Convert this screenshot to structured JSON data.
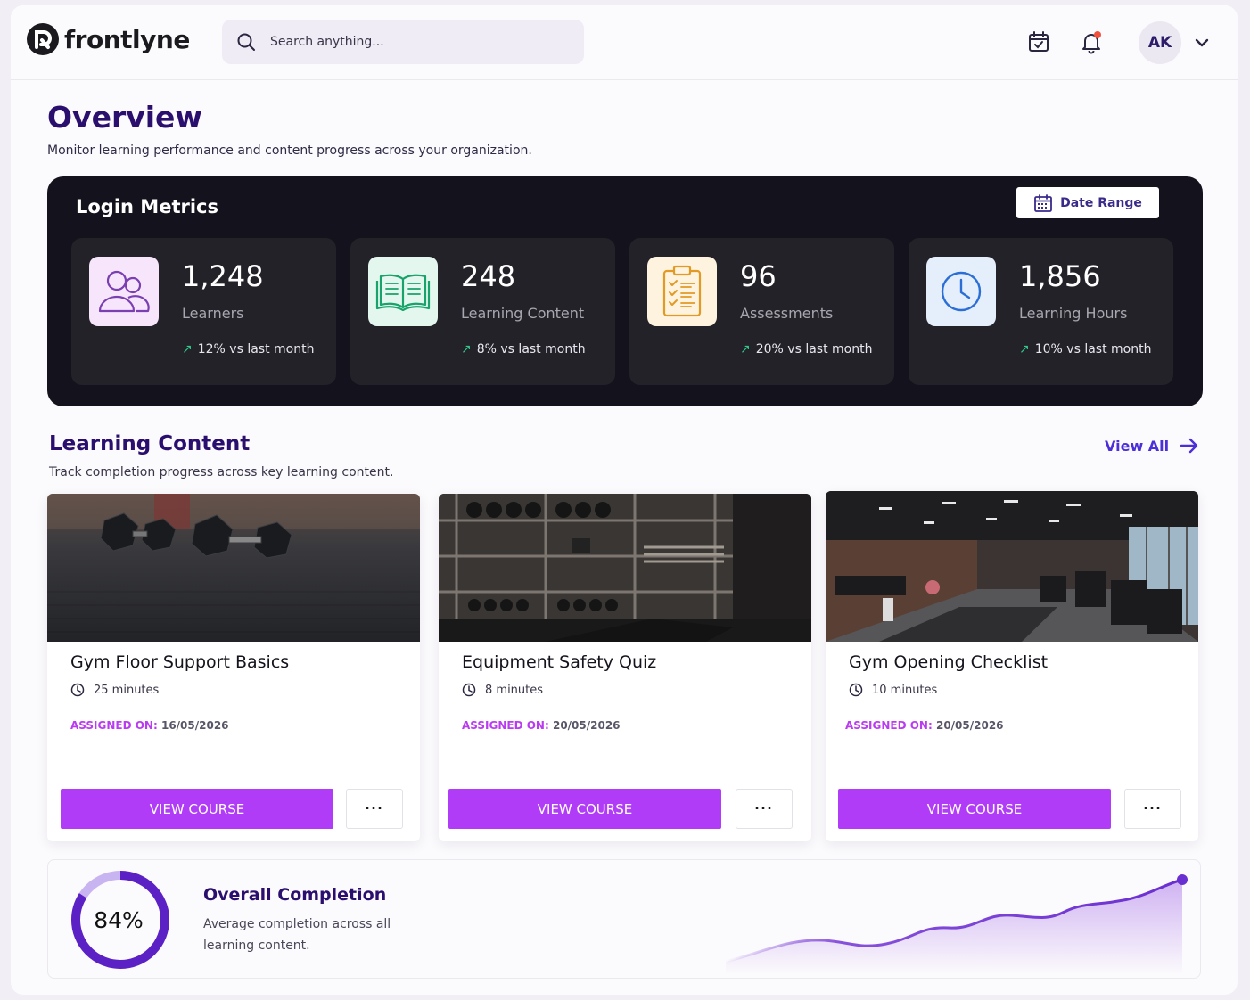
{
  "brand": {
    "name": "frontlyne"
  },
  "search": {
    "placeholder": "Search anything..."
  },
  "user": {
    "initials": "AK"
  },
  "page": {
    "title": "Overview",
    "subtitle": "Monitor learning performance and content progress across your organization."
  },
  "metrics": {
    "title": "Login Metrics",
    "date_range_label": "Date Range",
    "cards": [
      {
        "value": "1,248",
        "label": "Learners",
        "trend": "12% vs last month",
        "icon": "users-icon",
        "icon_bg": "#f7e6fb"
      },
      {
        "value": "248",
        "label": "Learning Content",
        "trend": "8% vs last month",
        "icon": "book-icon",
        "icon_bg": "#e4f7ef"
      },
      {
        "value": "96",
        "label": "Assessments",
        "trend": "20% vs last month",
        "icon": "clipboard-checklist-icon",
        "icon_bg": "#fdf3df"
      },
      {
        "value": "1,856",
        "label": "Learning Hours",
        "trend": "10% vs last month",
        "icon": "clock-icon",
        "icon_bg": "#e5eefb"
      }
    ]
  },
  "learning": {
    "title": "Learning Content",
    "subtitle": "Track completion progress across key learning content.",
    "view_all": "View All",
    "courses": [
      {
        "title": "Gym Floor Support Basics",
        "duration": "25 minutes",
        "assigned_label": "ASSIGNED ON:",
        "assigned_date": "16/05/2026",
        "button": "VIEW COURSE",
        "more": "···",
        "image": "dumbbells-photo"
      },
      {
        "title": "Equipment Safety Quiz",
        "duration": "8 minutes",
        "assigned_label": "ASSIGNED ON:",
        "assigned_date": "20/05/2026",
        "button": "VIEW COURSE",
        "more": "···",
        "image": "weights-rack-photo"
      },
      {
        "title": "Gym Opening Checklist",
        "duration": "10 minutes",
        "assigned_label": "ASSIGNED ON:",
        "assigned_date": "20/05/2026",
        "button": "VIEW COURSE",
        "more": "···",
        "image": "gym-interior-photo"
      }
    ]
  },
  "completion": {
    "title": "Overall Completion",
    "percent_label": "84%",
    "percent": 0.84,
    "subtitle": "Average completion across all learning content."
  },
  "colors": {
    "accent": "#b13cf8",
    "heading": "#2a0f6e",
    "panel": "#14131d",
    "ring": "#5b21c4",
    "trend_up": "#2fc98a"
  }
}
